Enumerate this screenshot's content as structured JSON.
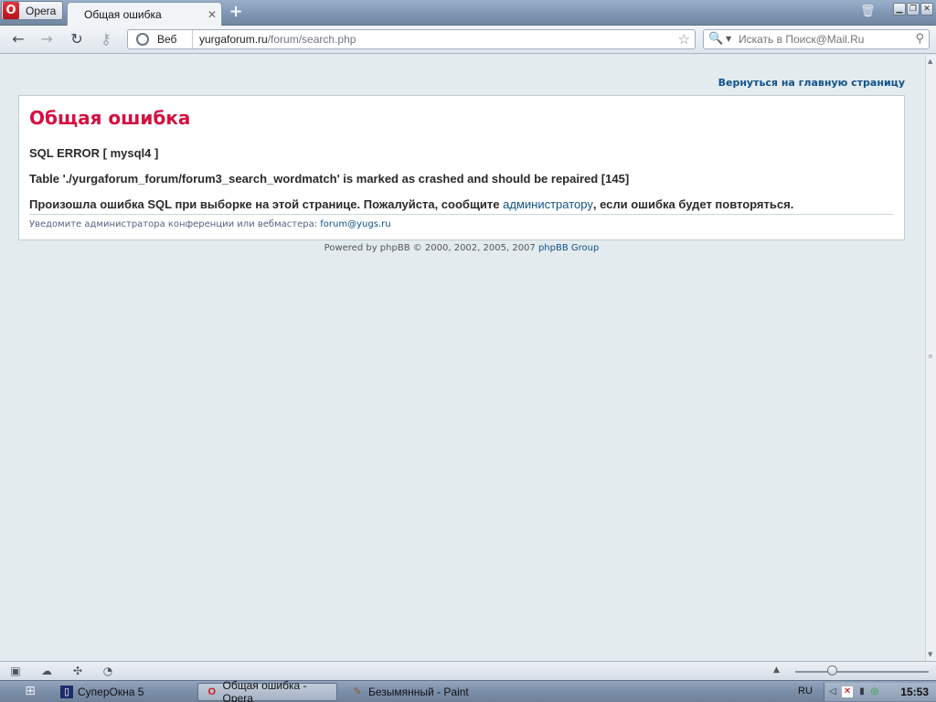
{
  "browser": {
    "menu_label": "Opera",
    "tab_title": "Общая ошибка",
    "address": {
      "mode_label": "Веб",
      "domain": "yurgaforum.ru",
      "path": "/forum/search.php"
    },
    "search_placeholder": "Искать в Поиск@Mail.Ru"
  },
  "page": {
    "back_link": "Вернуться на главную страницу",
    "error_title": "Общая ошибка",
    "sql_error": "SQL ERROR [ mysql4 ]",
    "table_message": "Table './yurgaforum_forum/forum3_search_wordmatch' is marked as crashed and should be repaired [145]",
    "notice_before": "Произошла ошибка SQL при выборке на этой странице. Пожалуйста, сообщите ",
    "notice_link": "администратору",
    "notice_after": ", если ошибка будет повторяться.",
    "notify_text": "Уведомите администратора конференции или вебмастера: ",
    "notify_email": "forum@yugs.ru",
    "powered_before": "Powered by phpBB © 2000, 2002, 2005, 2007 ",
    "powered_link": "phpBB Group"
  },
  "taskbar": {
    "items": [
      {
        "label": "СуперОкна 5",
        "icon": "app-window-icon"
      },
      {
        "label": "Общая ошибка - Opera",
        "icon": "opera-icon",
        "active": true
      },
      {
        "label": "Безымянный - Paint",
        "icon": "paint-icon"
      }
    ],
    "language": "RU",
    "clock": "15:53"
  },
  "colors": {
    "error_title": "#d31141",
    "link": "#105289",
    "page_background": "#e3ebef"
  }
}
